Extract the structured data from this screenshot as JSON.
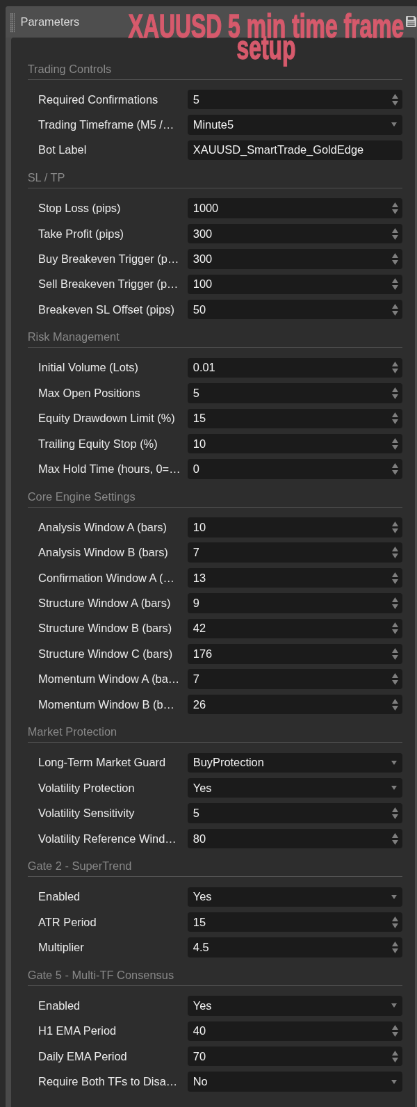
{
  "panel": {
    "title": "Parameters"
  },
  "overlay_caption": {
    "text": "XAUUSD 5 min time frame setup"
  },
  "sections": [
    {
      "title": "Trading Controls",
      "params": [
        {
          "label": "Required Confirmations",
          "kind": "number",
          "value": "5"
        },
        {
          "label": "Trading Timeframe (M5 /…",
          "kind": "select",
          "value": "Minute5"
        },
        {
          "label": "Bot Label",
          "kind": "text",
          "value": "XAUUSD_SmartTrade_GoldEdge"
        }
      ]
    },
    {
      "title": "SL / TP",
      "params": [
        {
          "label": "Stop Loss (pips)",
          "kind": "number",
          "value": "1000"
        },
        {
          "label": "Take Profit (pips)",
          "kind": "number",
          "value": "300"
        },
        {
          "label": "Buy Breakeven Trigger (p…",
          "kind": "number",
          "value": "300"
        },
        {
          "label": "Sell Breakeven Trigger (p…",
          "kind": "number",
          "value": "100"
        },
        {
          "label": "Breakeven SL Offset (pips)",
          "kind": "number",
          "value": "50"
        }
      ]
    },
    {
      "title": "Risk Management",
      "params": [
        {
          "label": "Initial Volume (Lots)",
          "kind": "number",
          "value": "0.01"
        },
        {
          "label": "Max Open Positions",
          "kind": "number",
          "value": "5"
        },
        {
          "label": "Equity Drawdown Limit (%)",
          "kind": "number",
          "value": "15"
        },
        {
          "label": "Trailing Equity Stop (%)",
          "kind": "number",
          "value": "10"
        },
        {
          "label": "Max Hold Time (hours, 0=…",
          "kind": "number",
          "value": "0"
        }
      ]
    },
    {
      "title": "Core Engine Settings",
      "params": [
        {
          "label": "Analysis Window A (bars)",
          "kind": "number",
          "value": "10"
        },
        {
          "label": "Analysis Window B (bars)",
          "kind": "number",
          "value": "7"
        },
        {
          "label": "Confirmation Window A (…",
          "kind": "number",
          "value": "13"
        },
        {
          "label": "Structure Window A (bars)",
          "kind": "number",
          "value": "9"
        },
        {
          "label": "Structure Window B (bars)",
          "kind": "number",
          "value": "42"
        },
        {
          "label": "Structure Window C (bars)",
          "kind": "number",
          "value": "176"
        },
        {
          "label": "Momentum Window A (ba…",
          "kind": "number",
          "value": "7"
        },
        {
          "label": "Momentum Window B (b…",
          "kind": "number",
          "value": "26"
        }
      ]
    },
    {
      "title": "Market Protection",
      "params": [
        {
          "label": "Long-Term Market Guard",
          "kind": "select",
          "value": "BuyProtection"
        },
        {
          "label": "Volatility Protection",
          "kind": "select",
          "value": "Yes"
        },
        {
          "label": "Volatility Sensitivity",
          "kind": "number",
          "value": "5"
        },
        {
          "label": "Volatility Reference Wind…",
          "kind": "number",
          "value": "80"
        }
      ]
    },
    {
      "title": "Gate 2 - SuperTrend",
      "params": [
        {
          "label": "Enabled",
          "kind": "select",
          "value": "Yes"
        },
        {
          "label": "ATR Period",
          "kind": "number",
          "value": "15"
        },
        {
          "label": "Multiplier",
          "kind": "number",
          "value": "4.5"
        }
      ]
    },
    {
      "title": "Gate 5 - Multi-TF Consensus",
      "params": [
        {
          "label": "Enabled",
          "kind": "select",
          "value": "Yes"
        },
        {
          "label": "H1 EMA Period",
          "kind": "number",
          "value": "40"
        },
        {
          "label": "Daily EMA Period",
          "kind": "number",
          "value": "70"
        },
        {
          "label": "Require Both TFs to Disa…",
          "kind": "select",
          "value": "No"
        }
      ]
    }
  ]
}
